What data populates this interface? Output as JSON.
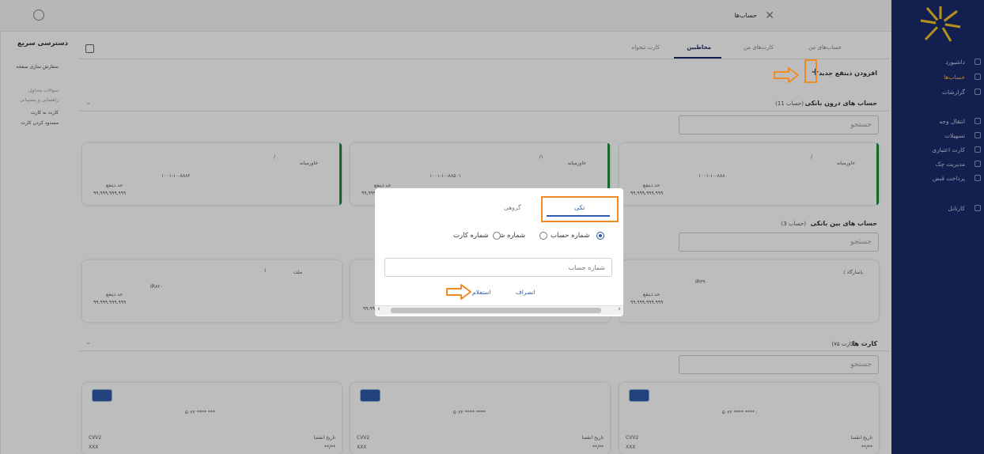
{
  "header": {
    "title": "حساب‌ها"
  },
  "tabs": [
    "حساب‌های من",
    "کارت‌های من",
    "مخاطبین",
    "کارت تنخواه"
  ],
  "add": {
    "label": "افزودن ذینفع جدید",
    "plus": "+"
  },
  "intra": {
    "title": "حساب های درون بانکی",
    "count": "(11 حساب)",
    "search_placeholder": "جستجو",
    "cards": [
      {
        "name": "خاورمیانه",
        "slash": "/",
        "number": "۱۰۰۱-۱۰-۸۸۸۰",
        "limit_label": "حد ذینفع",
        "limit": "۹۹,۹۹۹,۹۹۹,۹۹۹"
      },
      {
        "name": "خاورمیانه",
        "slash": "/۱",
        "number": "۱۰۰۱-۱۰-۸۸۵۰۱",
        "limit_label": "حد ذینفع",
        "limit": "۹۹,۹۹۹,۹۹۹,۹۹۹"
      },
      {
        "name": "خاورمیانه",
        "slash": "/",
        "number": "۱۰۰۱-۱۰-۸۸۸۲",
        "limit_label": "حد ذینفع",
        "limit": "۹۹,۹۹۹,۹۹۹,۹۹۹"
      }
    ]
  },
  "inter": {
    "title": "حساب های بین بانکی",
    "count": "(3 حساب)",
    "search_placeholder": "جستجو",
    "cards": [
      {
        "name": "/ پاسارگاد",
        "number": "IR۳۹۰",
        "limit_label": "حد ذینفع",
        "limit": "۹۹,۹۹۹,۹۹۹,۹۹۹"
      },
      {
        "name": "ملت",
        "slash": "I",
        "number": "IR۸۲۰",
        "limit_label": "حد ذینفع",
        "limit": "۹۹,۹۹۹,۹۹۹,۹۹۹"
      }
    ],
    "partial_limit": "۹۹,۹۹"
  },
  "cards_section": {
    "title": "کارت ها",
    "count": "(۷۵ کارت)",
    "search_placeholder": "جستجو",
    "cards": [
      {
        "number": "۵۰۲۲ **** **** :",
        "expiry_label": "تاریخ انقضا",
        "expiry": "**/**",
        "cvv_label": "CVV2",
        "cvv": "XXX"
      },
      {
        "number": "۵۰۲۲ **** ****",
        "expiry_label": "تاریخ انقضا",
        "expiry": "**/**",
        "cvv_label": "CVV2",
        "cvv": "XXX"
      },
      {
        "number": "۵۰۲۲ **** ***",
        "expiry_label": "تاریخ انقضا",
        "expiry": "**/**",
        "cvv_label": "CVV2",
        "cvv": "XXX"
      }
    ]
  },
  "sidebar": {
    "items": [
      "داشبورد",
      "حساب‌ها",
      "گزارشات",
      "انتقال وجه",
      "تسهیلات",
      "کارت اعتباری",
      "مدیریت چک",
      "پرداخت قبض",
      "کارتابل"
    ]
  },
  "quick": {
    "title": "دسترسی سریع",
    "items": [
      "سفارش سازی صفحه",
      "سوالات متداول",
      "راهنمایی و پشتیبانی",
      "کارت به کارت",
      "مسدود کردن کارت"
    ]
  },
  "modal": {
    "tab_single": "تکی",
    "tab_group": "گروهی",
    "radios": [
      "شماره حساب",
      "شماره شبا",
      "شماره کارت"
    ],
    "input_placeholder": "شماره حساب",
    "inquiry": "استعلام",
    "cancel": "انصراف"
  },
  "colors": {
    "sidebar": "#1a2a6a",
    "accent": "#f08a24",
    "primary": "#2f5aa8",
    "green": "#1f8a3b"
  }
}
